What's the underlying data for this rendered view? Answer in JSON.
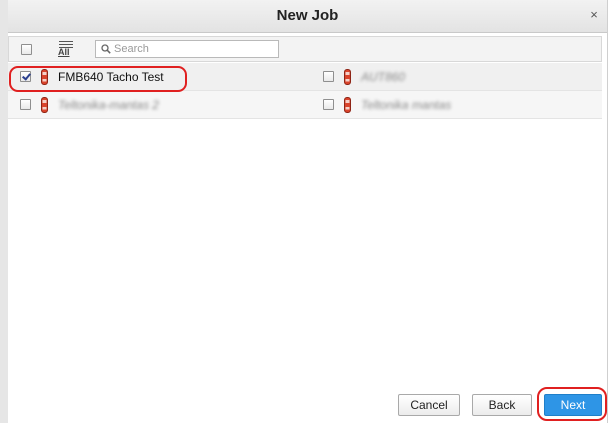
{
  "dialog": {
    "title": "New Job",
    "close_glyph": "×"
  },
  "toolbar": {
    "select_all_checked": false,
    "list_all_label": "All",
    "list_icon": "list-all-icon",
    "search_icon": "search-icon",
    "search_placeholder": "Search",
    "search_value": ""
  },
  "objects": [
    {
      "label": "FMB640 Tacho Test",
      "checked": true,
      "blurred": false,
      "icon": "car-icon"
    },
    {
      "label": "AUT860",
      "checked": false,
      "blurred": true,
      "icon": "car-icon"
    },
    {
      "label": "Teltonika-mantas 2",
      "checked": false,
      "blurred": true,
      "icon": "car-icon"
    },
    {
      "label": "Teltonika mantas",
      "checked": false,
      "blurred": true,
      "icon": "car-icon"
    }
  ],
  "footer": {
    "cancel_label": "Cancel",
    "back_label": "Back",
    "next_label": "Next"
  },
  "colors": {
    "accent": "#2e95e6",
    "highlight": "#e02020",
    "car": "#d9432b"
  }
}
